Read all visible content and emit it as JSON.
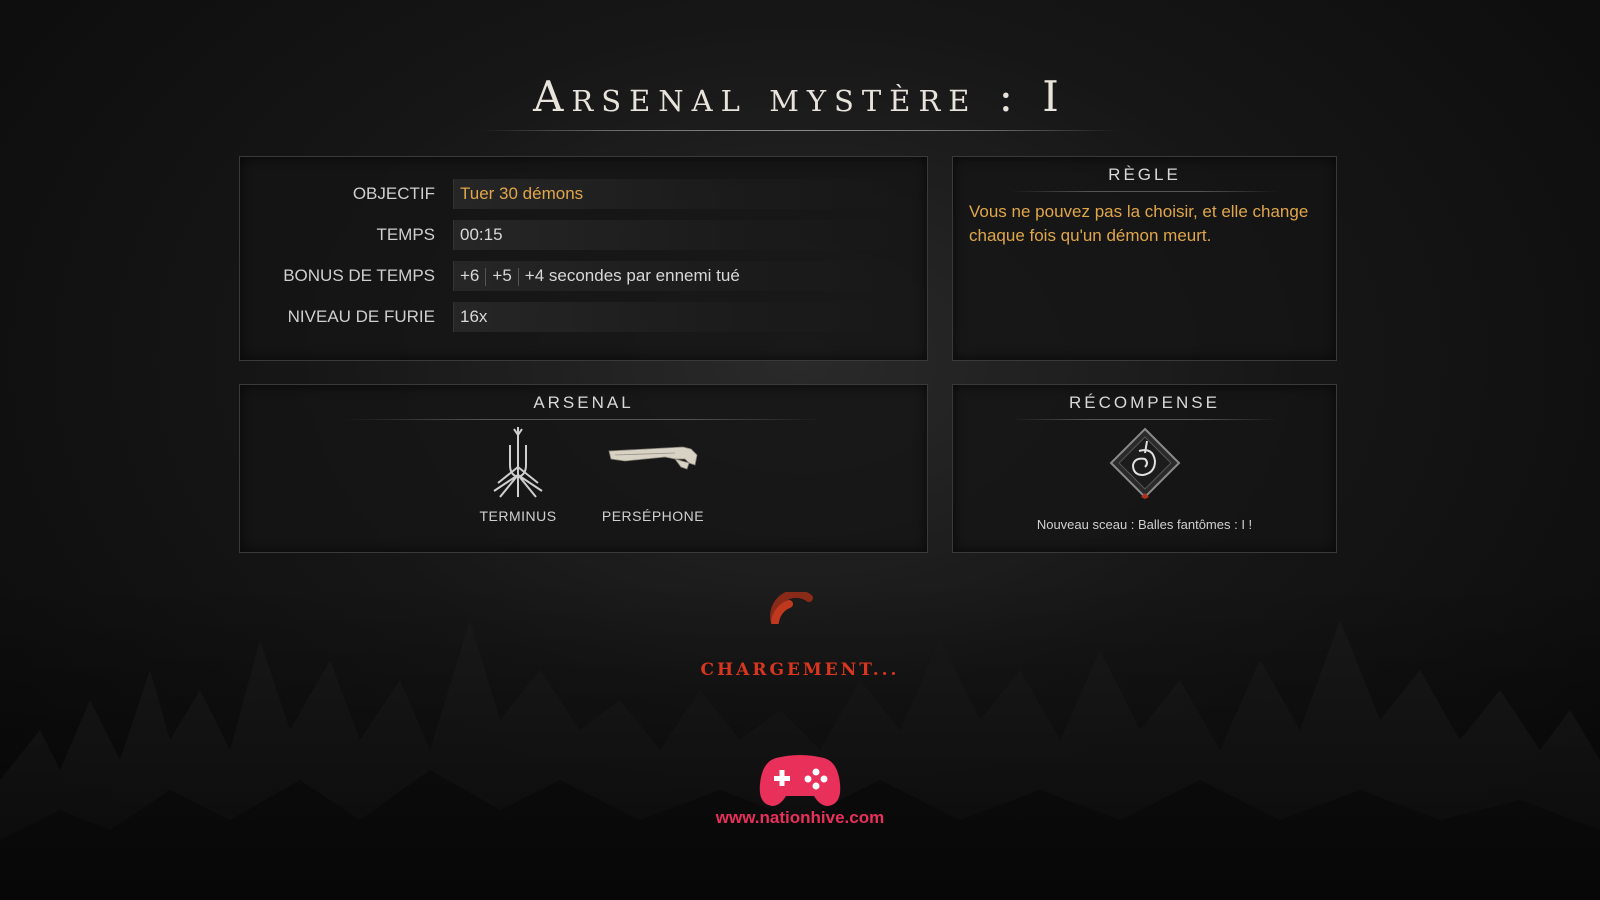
{
  "title": "Arsenal mystère : I",
  "objective_panel": {
    "rows": [
      {
        "label": "OBJECTIF",
        "value": "Tuer 30 démons"
      },
      {
        "label": "TEMPS",
        "value": "00:15"
      },
      {
        "label": "BONUS DE TEMPS",
        "bonus_1": "+6",
        "bonus_2": "+5",
        "bonus_3": "+4 secondes par ennemi tué"
      },
      {
        "label": "NIVEAU DE FURIE",
        "value": "16x"
      }
    ]
  },
  "rule_panel": {
    "header": "RÈGLE",
    "text": "Vous ne pouvez pas la choisir, et elle change chaque fois qu'un démon meurt."
  },
  "arsenal_panel": {
    "header": "ARSENAL",
    "weapons": [
      {
        "name": "TERMINUS",
        "icon": "trident-icon"
      },
      {
        "name": "PERSÉPHONE",
        "icon": "shotgun-icon"
      }
    ]
  },
  "reward_panel": {
    "header": "RÉCOMPENSE",
    "icon": "seal-icon",
    "text": "Nouveau sceau : Balles fantômes : I !"
  },
  "loading": {
    "text": "CHARGEMENT..."
  },
  "watermark": {
    "url": "www.nationhive.com",
    "icon": "gamepad-icon"
  },
  "colors": {
    "gold": "#e0a64a",
    "loading_red": "#d8361f",
    "watermark_pink": "#e8305a"
  }
}
